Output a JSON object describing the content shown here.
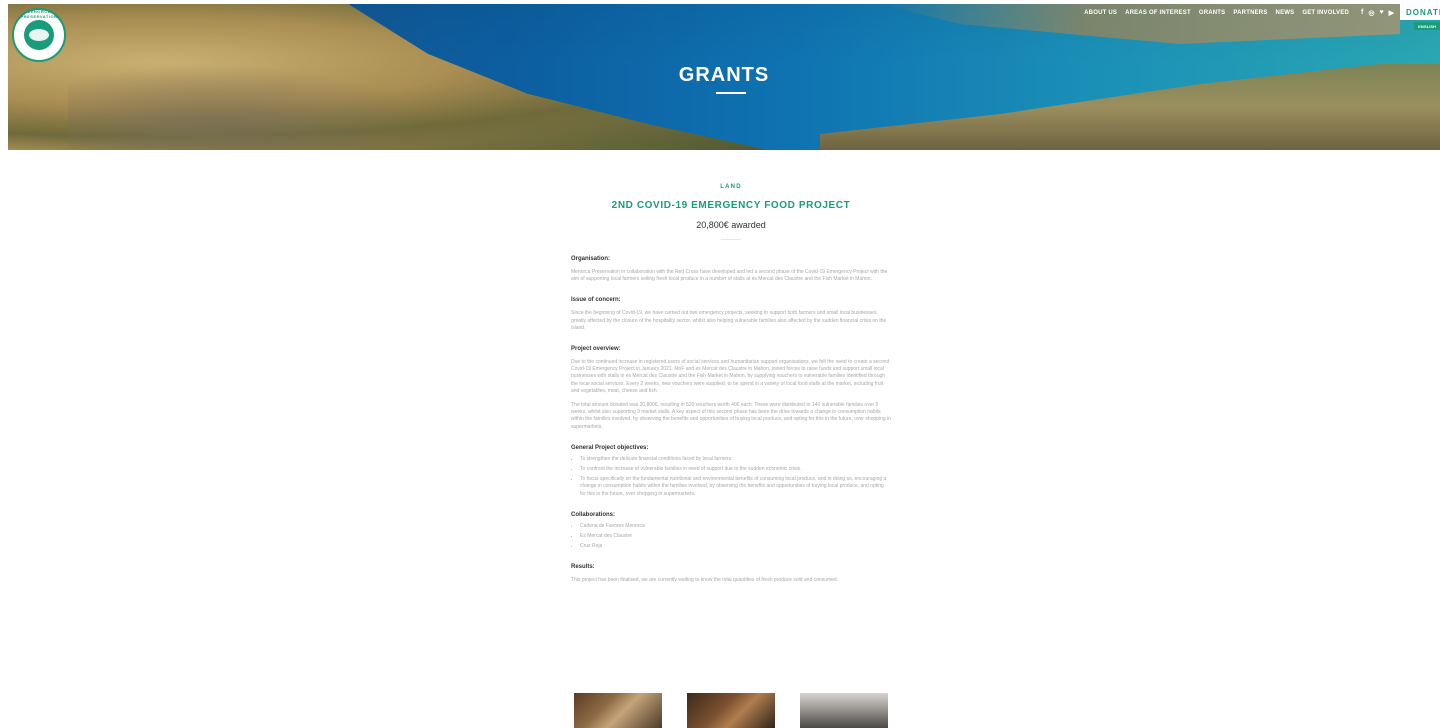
{
  "header": {
    "logo_text": "MENORCA PRESERVATION",
    "hero_title": "GRANTS",
    "nav": [
      "ABOUT US",
      "AREAS OF INTEREST",
      "GRANTS",
      "PARTNERS",
      "NEWS",
      "GET INVOLVED"
    ],
    "social_icons": [
      "facebook-icon",
      "instagram-icon",
      "twitter-icon",
      "youtube-icon"
    ],
    "social_glyphs": [
      "f",
      "◎",
      "♥",
      "▶"
    ],
    "donate_label": "DONATE",
    "language_label": "ENGLISH"
  },
  "project": {
    "category": "LAND",
    "title": "2ND COVID-19 EMERGENCY FOOD PROJECT",
    "awarded": "20,800€ awarded",
    "sections": {
      "organisation": {
        "heading": "Organisation:",
        "text": "Menorca Preservation in collaboration with the Red Cross have developed and led a second phase of the Covid-19 Emergency Project with the aim of supporting local farmers selling fresh local produce in a number of stalls at es Mercat des Claustre and the Fish Market in Mahon."
      },
      "issue": {
        "heading": "Issue of concern:",
        "text": "Since the beginning of Covid-19, we have carried out two emergency projects, seeking to support both farmers and small local businesses, greatly affected by the closure of the hospitality sector, whilst also helping vulnerable families also affected by the sudden financial crisis on the island."
      },
      "overview": {
        "heading": "Project overview:",
        "text1": "Due to the continued increase in registered users of social services and humanitarian support organisations, we felt the need to create a second Covid-19 Emergency Project in January 2021. MoF and es Mercat des Claustre in Mahon, joined forces to raise funds and support small local businesses with stalls in es Mercat des Claustre and the Fish Market in Mahon, by supplying vouchers to vulnerable families identified through the local social services. Every 2 weeks, new vouchers were supplied, to be spend in a variety of local food stalls at the market, including fruit and vegetables, meat, cheese and fish.",
        "text2": "The total amount donated was 20,800€, resulting in 520 vouchers worth 40€ each. These were distributed to 140 vulnerable families over 9 weeks, whilst also supporting 9 market stalls. A key aspect of this second phase has been the drive towards a change in consumption habits within the families involved, by observing the benefits and opportunities of buying local produce, and opting for this in the future, over shopping in supermarkets."
      },
      "objectives": {
        "heading": "General Project objectives:",
        "items": [
          "To strengthen the delicate financial conditions faced by local farmers.",
          "To confront the increase of vulnerable families in need of support due to the sudden economic crisis.",
          "To focus specifically on the fundamental nutritional and environmental benefits of consuming local produce, and in doing so, encouraging a change in consumption habits within the families involved, by observing the benefits and opportunities of buying local produce, and opting for this in the future, over shopping in supermarkets."
        ]
      },
      "collaborations": {
        "heading": "Collaborations:",
        "items": [
          "Cadena de Favores Menorca",
          "Es Mercat des Claustre",
          "Cruz Roja"
        ]
      },
      "results": {
        "heading": "Results:",
        "text": "This project has been finalised, we are currently waiting to know the total quantities of fresh produce sold and consumed."
      }
    }
  }
}
